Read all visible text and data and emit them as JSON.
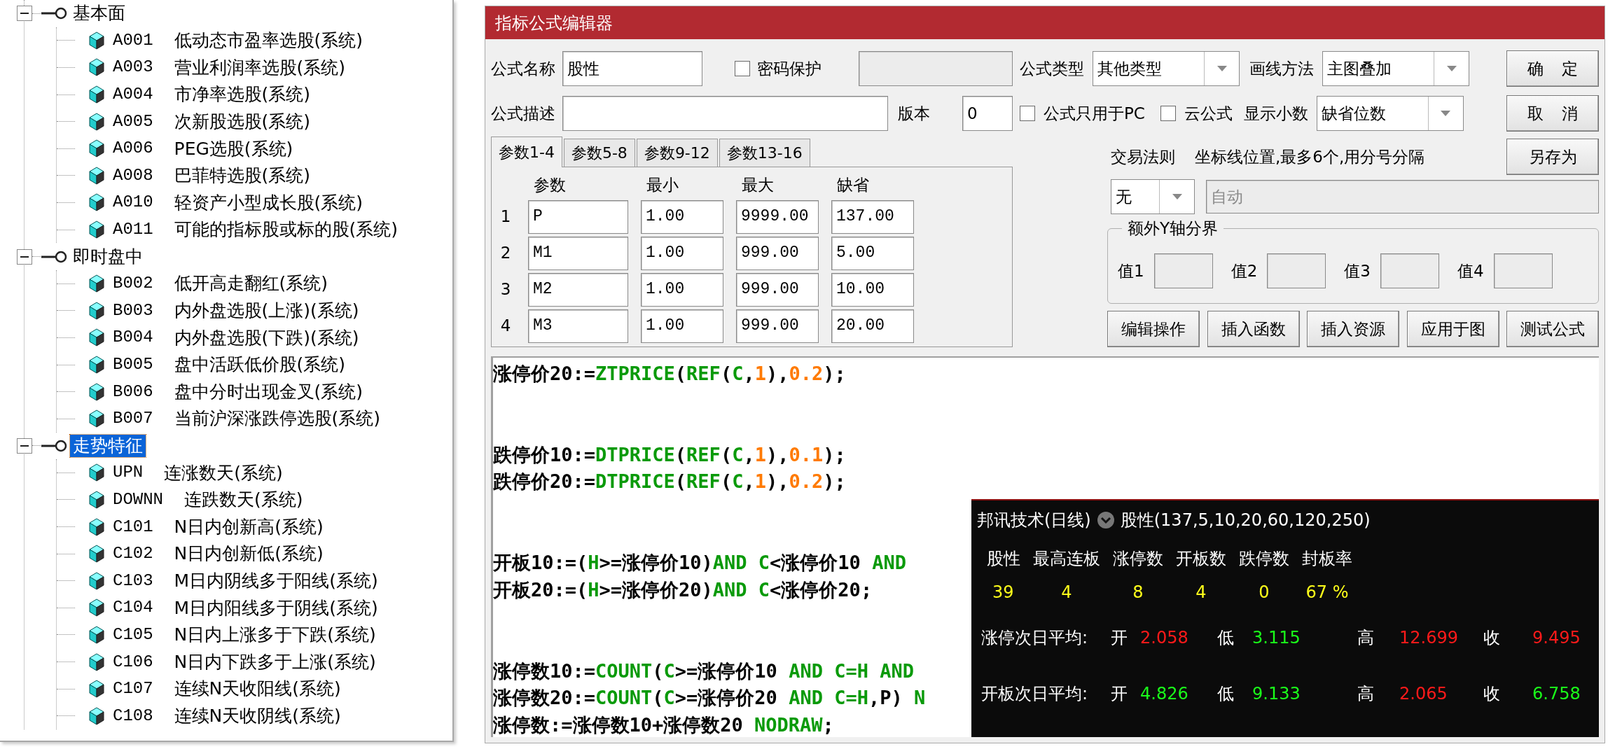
{
  "tree": {
    "groups": [
      {
        "label": "基本面",
        "expanded": true,
        "selected": false,
        "items": [
          {
            "code": "A001",
            "name": "低动态市盈率选股(系统)"
          },
          {
            "code": "A003",
            "name": "营业利润率选股(系统)"
          },
          {
            "code": "A004",
            "name": "市净率选股(系统)"
          },
          {
            "code": "A005",
            "name": "次新股选股(系统)"
          },
          {
            "code": "A006",
            "name": "PEG选股(系统)"
          },
          {
            "code": "A008",
            "name": "巴菲特选股(系统)"
          },
          {
            "code": "A010",
            "name": "轻资产小型成长股(系统)"
          },
          {
            "code": "A011",
            "name": "可能的指标股或标的股(系统)"
          }
        ]
      },
      {
        "label": "即时盘中",
        "expanded": true,
        "selected": false,
        "items": [
          {
            "code": "B002",
            "name": "低开高走翻红(系统)"
          },
          {
            "code": "B003",
            "name": "内外盘选股(上涨)(系统)"
          },
          {
            "code": "B004",
            "name": "内外盘选股(下跌)(系统)"
          },
          {
            "code": "B005",
            "name": "盘中活跃低价股(系统)"
          },
          {
            "code": "B006",
            "name": "盘中分时出现金叉(系统)"
          },
          {
            "code": "B007",
            "name": "当前沪深涨跌停选股(系统)"
          }
        ]
      },
      {
        "label": "走势特征",
        "expanded": true,
        "selected": true,
        "items": [
          {
            "code": "UPN",
            "name": "连涨数天(系统)"
          },
          {
            "code": "DOWNN",
            "name": "连跌数天(系统)"
          },
          {
            "code": "C101",
            "name": "N日内创新高(系统)"
          },
          {
            "code": "C102",
            "name": "N日内创新低(系统)"
          },
          {
            "code": "C103",
            "name": "M日内阴线多于阳线(系统)"
          },
          {
            "code": "C104",
            "name": "M日内阳线多于阴线(系统)"
          },
          {
            "code": "C105",
            "name": "N日内上涨多于下跌(系统)"
          },
          {
            "code": "C106",
            "name": "N日内下跌多于上涨(系统)"
          },
          {
            "code": "C107",
            "name": "连续N天收阳线(系统)"
          },
          {
            "code": "C108",
            "name": "连续N天收阴线(系统)"
          }
        ]
      }
    ]
  },
  "editor": {
    "title": "指标公式编辑器",
    "name_label": "公式名称",
    "name_value": "股性",
    "password": {
      "label": "密码保护",
      "checked": false,
      "field_disabled": true
    },
    "desc_label": "公式描述",
    "version_label": "版本",
    "version_value": "0",
    "tabs": [
      {
        "label": "参数1-4",
        "selected": true
      },
      {
        "label": "参数5-8",
        "selected": false
      },
      {
        "label": "参数9-12",
        "selected": false
      },
      {
        "label": "参数13-16",
        "selected": false
      }
    ],
    "param_columns": [
      "参数",
      "最小",
      "最大",
      "缺省"
    ],
    "params": [
      {
        "index": "1",
        "cells": [
          "P",
          "1.00",
          "9999.00",
          "137.00"
        ]
      },
      {
        "index": "2",
        "cells": [
          "M1",
          "1.00",
          "999.00",
          "5.00"
        ]
      },
      {
        "index": "3",
        "cells": [
          "M2",
          "1.00",
          "999.00",
          "10.00"
        ]
      },
      {
        "index": "4",
        "cells": [
          "M3",
          "1.00",
          "999.00",
          "20.00"
        ]
      }
    ],
    "type_label": "公式类型",
    "type_value": "其他类型",
    "draw_label": "画线方法",
    "draw_value": "主图叠加",
    "pc_only": {
      "label": "公式只用于PC",
      "checked": false
    },
    "cloud": {
      "label": "云公式",
      "checked": false
    },
    "decimals_label": "显示小数",
    "decimals_value": "缺省位数",
    "trade_label": "交易法则",
    "trade_value": "无",
    "axis_label": "坐标线位置,最多6个,用分号分隔",
    "axis_value": "自动",
    "axis_disabled": true,
    "yaxis": {
      "title": "额外Y轴分界",
      "fields": [
        {
          "label": "值1",
          "disabled": true
        },
        {
          "label": "值2",
          "disabled": true
        },
        {
          "label": "值3",
          "disabled": true
        },
        {
          "label": "值4",
          "disabled": true
        }
      ]
    },
    "side_buttons": [
      "确 定",
      "取 消",
      "另存为"
    ],
    "bottom_buttons": [
      "编辑操作",
      "插入函数",
      "插入资源",
      "应用于图",
      "测试公式"
    ],
    "code": {
      "blocks": [
        [
          [
            {
              "kind": "plain",
              "text": "涨停价20:="
            },
            {
              "kind": "func",
              "text": "ZTPRICE"
            },
            {
              "kind": "plain",
              "text": "("
            },
            {
              "kind": "func",
              "text": "REF"
            },
            {
              "kind": "plain",
              "text": "("
            },
            {
              "kind": "func",
              "text": "C"
            },
            {
              "kind": "plain",
              "text": ","
            },
            {
              "kind": "num",
              "text": "1"
            },
            {
              "kind": "plain",
              "text": "),"
            },
            {
              "kind": "num",
              "text": "0.2"
            },
            {
              "kind": "plain",
              "text": ");"
            }
          ]
        ],
        [
          [
            {
              "kind": "plain",
              "text": "跌停价10:="
            },
            {
              "kind": "func",
              "text": "DTPRICE"
            },
            {
              "kind": "plain",
              "text": "("
            },
            {
              "kind": "func",
              "text": "REF"
            },
            {
              "kind": "plain",
              "text": "("
            },
            {
              "kind": "func",
              "text": "C"
            },
            {
              "kind": "plain",
              "text": ","
            },
            {
              "kind": "num",
              "text": "1"
            },
            {
              "kind": "plain",
              "text": "),"
            },
            {
              "kind": "num",
              "text": "0.1"
            },
            {
              "kind": "plain",
              "text": ");"
            }
          ],
          [
            {
              "kind": "plain",
              "text": "跌停价20:="
            },
            {
              "kind": "func",
              "text": "DTPRICE"
            },
            {
              "kind": "plain",
              "text": "("
            },
            {
              "kind": "func",
              "text": "REF"
            },
            {
              "kind": "plain",
              "text": "("
            },
            {
              "kind": "func",
              "text": "C"
            },
            {
              "kind": "plain",
              "text": ","
            },
            {
              "kind": "num",
              "text": "1"
            },
            {
              "kind": "plain",
              "text": "),"
            },
            {
              "kind": "num",
              "text": "0.2"
            },
            {
              "kind": "plain",
              "text": ");"
            }
          ]
        ],
        [
          [
            {
              "kind": "plain",
              "text": "开板10:=("
            },
            {
              "kind": "func",
              "text": "H"
            },
            {
              "kind": "plain",
              "text": ">=涨停价10)"
            },
            {
              "kind": "func",
              "text": "AND C"
            },
            {
              "kind": "plain",
              "text": "<涨停价10 "
            },
            {
              "kind": "func",
              "text": "AND"
            }
          ],
          [
            {
              "kind": "plain",
              "text": "开板20:=("
            },
            {
              "kind": "func",
              "text": "H"
            },
            {
              "kind": "plain",
              "text": ">=涨停价20)"
            },
            {
              "kind": "func",
              "text": "AND C"
            },
            {
              "kind": "plain",
              "text": "<涨停价20;"
            }
          ]
        ],
        [
          [
            {
              "kind": "plain",
              "text": "涨停数10:="
            },
            {
              "kind": "func",
              "text": "COUNT"
            },
            {
              "kind": "plain",
              "text": "("
            },
            {
              "kind": "func",
              "text": "C"
            },
            {
              "kind": "plain",
              "text": ">=涨停价10 "
            },
            {
              "kind": "func",
              "text": "AND C=H AND"
            }
          ],
          [
            {
              "kind": "plain",
              "text": "涨停数20:="
            },
            {
              "kind": "func",
              "text": "COUNT"
            },
            {
              "kind": "plain",
              "text": "("
            },
            {
              "kind": "func",
              "text": "C"
            },
            {
              "kind": "plain",
              "text": ">=涨停价20 "
            },
            {
              "kind": "func",
              "text": "AND C=H"
            },
            {
              "kind": "plain",
              "text": ",P) "
            },
            {
              "kind": "func",
              "text": "N"
            }
          ],
          [
            {
              "kind": "plain",
              "text": "涨停数:=涨停数10+涨停数20 "
            },
            {
              "kind": "func",
              "text": "NODRAW"
            },
            {
              "kind": "plain",
              "text": ";"
            }
          ]
        ]
      ]
    }
  },
  "overlay": {
    "title": "邦讯技术(日线)",
    "formula": "股性(137,5,10,20,60,120,250)",
    "columns": [
      "股性",
      "最高连板",
      "涨停数",
      "开板数",
      "跌停数",
      "封板率"
    ],
    "values": [
      "39",
      "4",
      "8",
      "4",
      "0",
      "67 %"
    ],
    "rows": [
      {
        "title": "涨停次日平均:",
        "items": [
          {
            "label": "开",
            "value": "2.058",
            "color": "#ff1a1a"
          },
          {
            "label": "低",
            "value": "3.115",
            "color": "#1aff1a"
          },
          {
            "label": "高",
            "value": "12.699",
            "color": "#ff1a1a"
          },
          {
            "label": "收",
            "value": "9.495",
            "color": "#ff1a1a"
          }
        ]
      },
      {
        "title": "开板次日平均:",
        "items": [
          {
            "label": "开",
            "value": "4.826",
            "color": "#1aff1a"
          },
          {
            "label": "低",
            "value": "9.133",
            "color": "#1aff1a"
          },
          {
            "label": "高",
            "value": "2.065",
            "color": "#ff1a1a"
          },
          {
            "label": "收",
            "value": "6.758",
            "color": "#1aff1a"
          }
        ]
      }
    ]
  }
}
